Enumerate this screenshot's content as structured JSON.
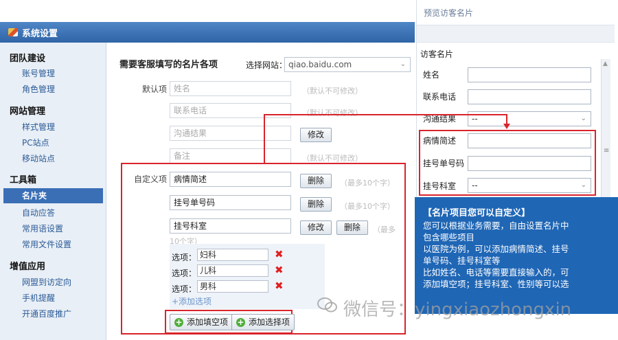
{
  "window": {
    "title": "系统设置"
  },
  "sidebar": {
    "sections": [
      {
        "title": "团队建设",
        "items": [
          "账号管理",
          "角色管理"
        ]
      },
      {
        "title": "网站管理",
        "items": [
          "样式管理",
          "PC站点",
          "移动站点"
        ]
      },
      {
        "title": "工具箱",
        "items": [
          "名片夹",
          "自动应答",
          "常用语设置",
          "常用文件设置"
        ]
      },
      {
        "title": "增值应用",
        "items": [
          "网盟到访定向",
          "手机提醒",
          "开通百度推广"
        ]
      }
    ],
    "active_item": "名片夹"
  },
  "main": {
    "title": "需要客服填写的名片各项",
    "site_label": "选择网站：",
    "site_value": "qiao.baidu.com",
    "default_label": "默认项",
    "default_fields": [
      {
        "value": "姓名",
        "hint": "（默认不可修改）"
      },
      {
        "value": "联系电话",
        "hint": "（默认不可修改）"
      },
      {
        "value": "沟通结果",
        "button": "修改"
      },
      {
        "value": "备注",
        "hint": "（默认不可修改）"
      }
    ],
    "custom_label": "自定义项",
    "custom_fields": [
      {
        "value": "病情简述",
        "delete": "删除",
        "hint": "（最多10个字）"
      },
      {
        "value": "挂号单号码",
        "delete": "删除",
        "hint": "（最多10个字）"
      },
      {
        "value": "挂号科室",
        "edit": "修改",
        "delete": "删除",
        "hint": "（最多",
        "hint2": "10个字）"
      }
    ],
    "options": [
      {
        "label": "选项：",
        "value": "妇科"
      },
      {
        "label": "选项：",
        "value": "儿科"
      },
      {
        "label": "选项：",
        "value": "男科"
      }
    ],
    "add_option": "+添加选项",
    "add_blank_button": "添加填空项",
    "add_select_button": "添加选择项"
  },
  "preview": {
    "title": "预览访客名片",
    "subtitle": "访客名片",
    "fields": [
      {
        "label": "姓名",
        "value": ""
      },
      {
        "label": "联系电话",
        "value": ""
      },
      {
        "label": "沟通结果",
        "value": "--",
        "select": true
      },
      {
        "label": "病情简述",
        "value": ""
      },
      {
        "label": "挂号单号码",
        "value": ""
      },
      {
        "label": "挂号科室",
        "value": "--",
        "select": true
      }
    ]
  },
  "info": {
    "heading": "【名片项目您可以自定义】",
    "lines": [
      "您可以根据业务需要，自由设置名片中",
      "包含哪些项目",
      "以医院为例，可以添加病情简述、挂号",
      "单号码、挂号科室等",
      "比如姓名、电话等需要直接输入的，可",
      "添加填空项；挂号科室、性别等可以选"
    ]
  },
  "watermark": {
    "text": "微信号：yingxiaozhongxin"
  },
  "colors": {
    "accent": "#2f64a6",
    "highlight": "#d9232b",
    "info_bg": "#1f66b5"
  }
}
